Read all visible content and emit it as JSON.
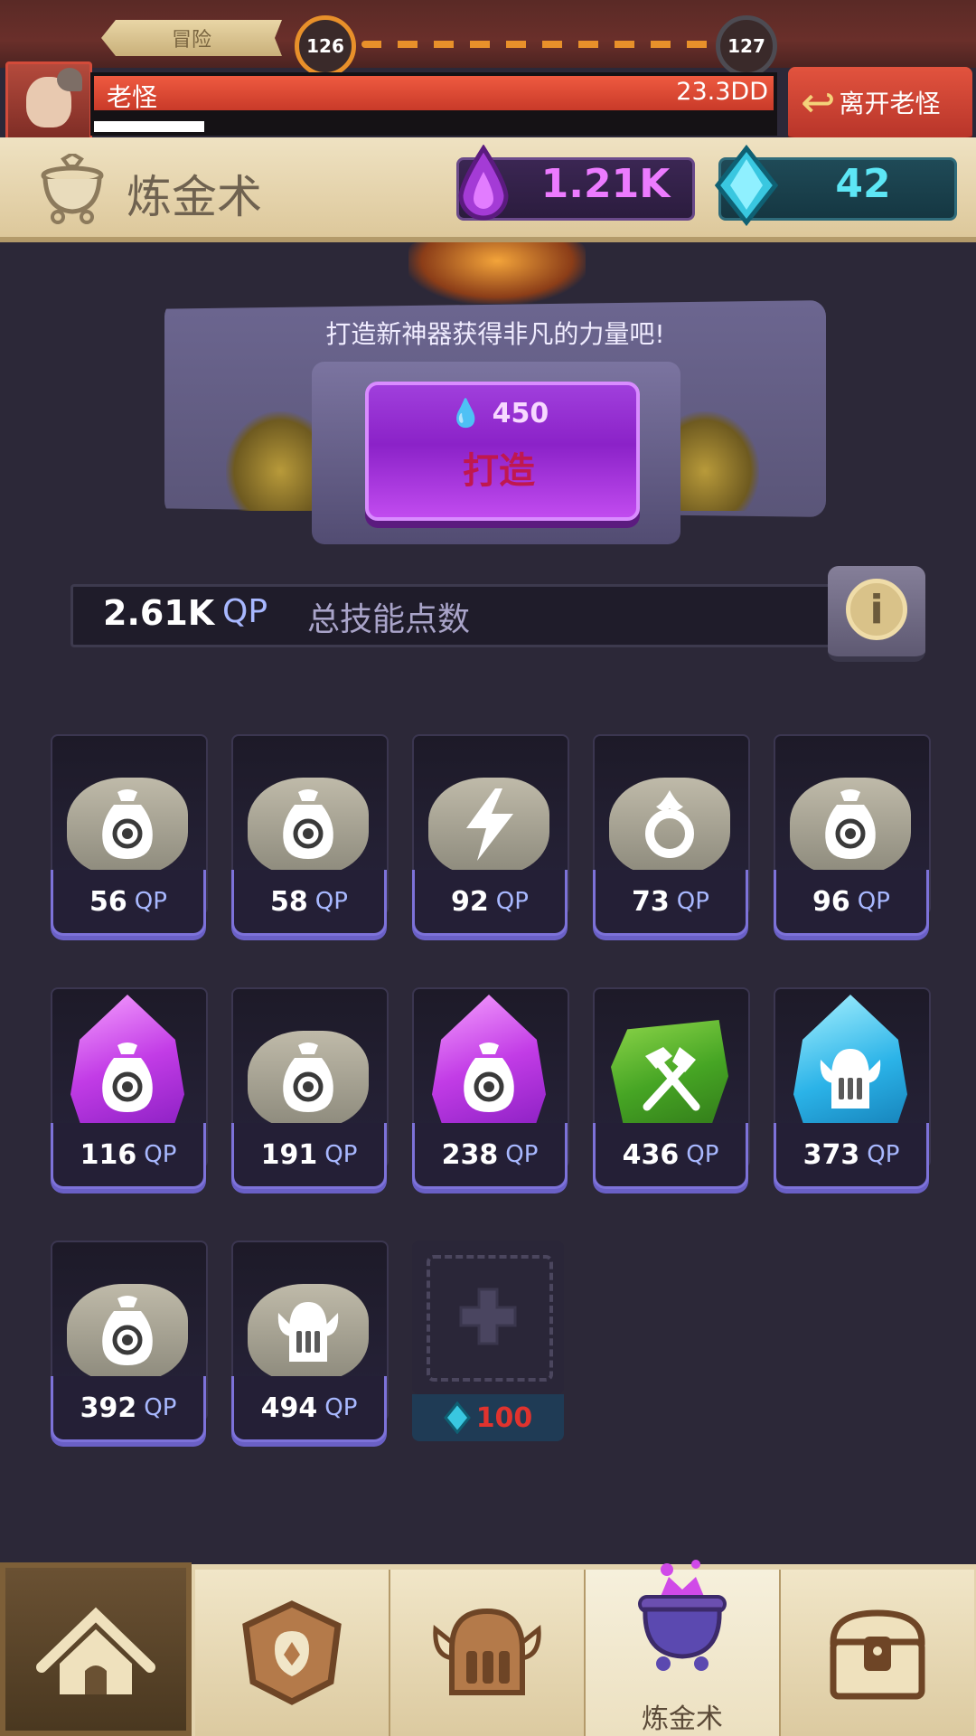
{
  "progress": {
    "mode_label": "冒险",
    "current_stage": "126",
    "next_stage": "127"
  },
  "boss": {
    "name": "老怪",
    "hp": "23.3DD",
    "leave_label": "离开老怪"
  },
  "header": {
    "title": "炼金术",
    "essence": "1.21K",
    "gems": "42"
  },
  "forge": {
    "hint": "打造新神器获得非凡的力量吧!",
    "cost": "450",
    "button_label": "打造"
  },
  "skill_points": {
    "value": "2.61K",
    "unit": "QP",
    "label": "总技能点数"
  },
  "artifacts": [
    {
      "qp": "56",
      "unit": "QP",
      "kind": "stone",
      "icon": "money-bag-icon"
    },
    {
      "qp": "58",
      "unit": "QP",
      "kind": "stone",
      "icon": "money-bag-icon"
    },
    {
      "qp": "92",
      "unit": "QP",
      "kind": "stone",
      "icon": "lightning-icon"
    },
    {
      "qp": "73",
      "unit": "QP",
      "kind": "stone",
      "icon": "fire-ring-icon"
    },
    {
      "qp": "96",
      "unit": "QP",
      "kind": "stone",
      "icon": "money-bag-icon"
    },
    {
      "qp": "116",
      "unit": "QP",
      "kind": "purple-crystal",
      "icon": "money-bag-icon"
    },
    {
      "qp": "191",
      "unit": "QP",
      "kind": "stone",
      "icon": "money-bag-icon"
    },
    {
      "qp": "238",
      "unit": "QP",
      "kind": "purple-crystal",
      "icon": "money-bag-icon"
    },
    {
      "qp": "436",
      "unit": "QP",
      "kind": "green-crystal",
      "icon": "hammer-axe-icon"
    },
    {
      "qp": "373",
      "unit": "QP",
      "kind": "blue-crystal",
      "icon": "viking-helmet-icon"
    },
    {
      "qp": "392",
      "unit": "QP",
      "kind": "stone",
      "icon": "money-bag-icon"
    },
    {
      "qp": "494",
      "unit": "QP",
      "kind": "stone",
      "icon": "viking-helmet-icon"
    }
  ],
  "add_slot": {
    "cost": "100"
  },
  "nav": {
    "tabs": [
      "home-tab",
      "shield-tab",
      "hero-tab",
      "alchemy-tab",
      "chest-tab"
    ],
    "active_label": "炼金术"
  },
  "colors": {
    "accent_purple": "#8b22c8",
    "essence": "#ec7bff",
    "gems": "#5de6f5",
    "qp_unit": "#a8b8ff",
    "forge_label": "#c0184e",
    "add_cost": "#e0332e"
  }
}
